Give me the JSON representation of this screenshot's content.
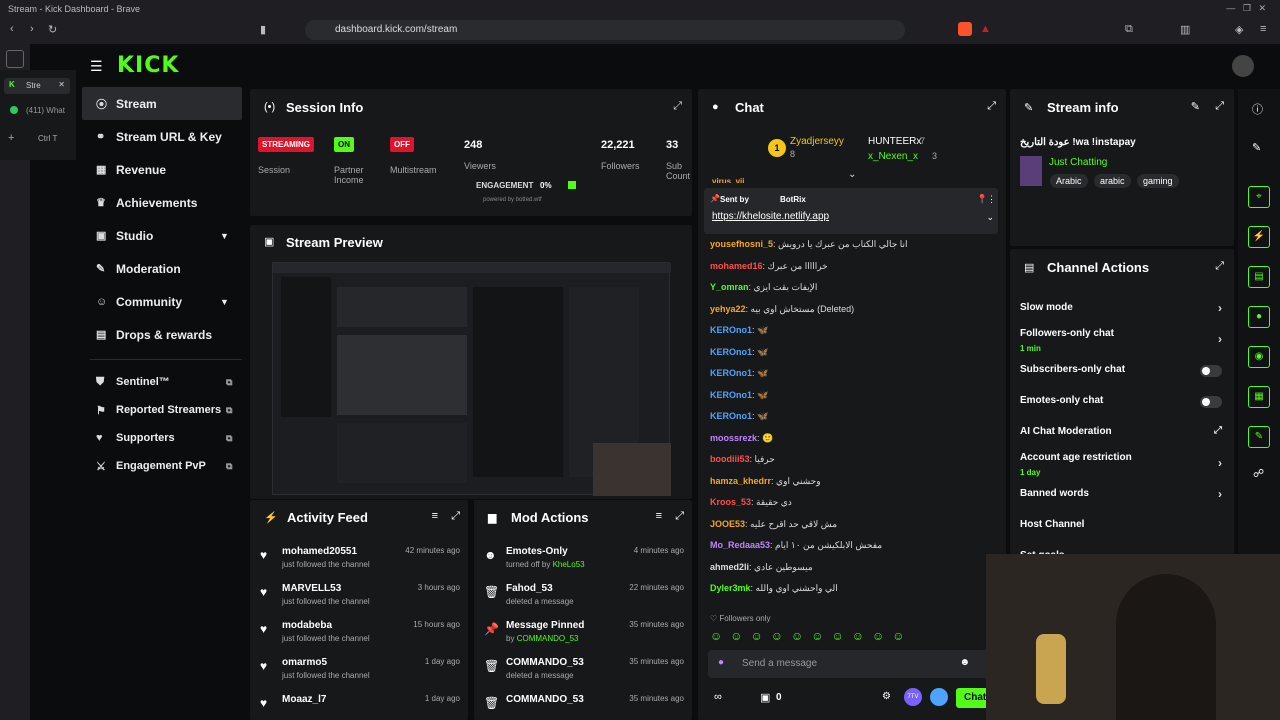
{
  "window_title": "Stream - Kick Dashboard - Brave",
  "url": "dashboard.kick.com/stream",
  "tabs": [
    {
      "label": "Stre"
    },
    {
      "label": "(411) What"
    }
  ],
  "tab_shortcut": "Ctrl T",
  "logo": "KICK",
  "sidebar": {
    "items": [
      {
        "label": "Stream"
      },
      {
        "label": "Stream URL & Key"
      },
      {
        "label": "Revenue"
      },
      {
        "label": "Achievements"
      },
      {
        "label": "Studio"
      },
      {
        "label": "Moderation"
      },
      {
        "label": "Community"
      },
      {
        "label": "Drops & rewards"
      }
    ],
    "tools": [
      {
        "label": "Sentinel™"
      },
      {
        "label": "Reported Streamers"
      },
      {
        "label": "Supporters"
      },
      {
        "label": "Engagement PvP"
      }
    ]
  },
  "session": {
    "title": "Session Info",
    "streaming": "STREAMING",
    "session_label": "Session",
    "on": "ON",
    "partner_label": "Partner Income",
    "off": "OFF",
    "multistream_label": "Multistream",
    "viewers": "248",
    "viewers_label": "Viewers",
    "followers": "22,221",
    "followers_label": "Followers",
    "subs": "33",
    "subs_label": "Sub Counts",
    "engagement_label": "ENGAGEMENT",
    "engagement": "0%",
    "powered": "powered by botted.wtf"
  },
  "preview": {
    "title": "Stream Preview"
  },
  "activity": {
    "title": "Activity Feed",
    "items": [
      {
        "name": "mohamed20551",
        "desc": "just followed the channel",
        "time": "42 minutes ago"
      },
      {
        "name": "MARVELL53",
        "desc": "just followed the channel",
        "time": "3 hours ago"
      },
      {
        "name": "modabeba",
        "desc": "just followed the channel",
        "time": "15 hours ago"
      },
      {
        "name": "omarmo5",
        "desc": "just followed the channel",
        "time": "1 day ago"
      },
      {
        "name": "Moaaz_l7",
        "desc": "",
        "time": "1 day ago"
      }
    ]
  },
  "modactions": {
    "title": "Mod Actions",
    "items": [
      {
        "name": "Emotes-Only",
        "desc": "turned off by",
        "user": "KheLo53",
        "time": "4 minutes ago"
      },
      {
        "name": "Fahod_53",
        "desc": "deleted a message",
        "user": "",
        "time": "22 minutes ago"
      },
      {
        "name": "Message Pinned",
        "desc": "by",
        "user": "COMMANDO_53",
        "time": "35 minutes ago"
      },
      {
        "name": "COMMANDO_53",
        "desc": "deleted a message",
        "user": "",
        "time": "35 minutes ago"
      },
      {
        "name": "COMMANDO_53",
        "desc": "",
        "user": "",
        "time": "35 minutes ago"
      }
    ]
  },
  "chat": {
    "title": "Chat",
    "top1": "Zyadjerseyy",
    "top1_count": "8",
    "top2": "HUNTEERx",
    "top2_count": "7",
    "top3": "x_Nexen_x",
    "top3_count": "3",
    "pinned_by": "Sent by",
    "pinned_user": "BotRix",
    "pinned_link": "https://khelosite.netlify.app",
    "cut_user": "virus_vii",
    "messages": [
      {
        "user": "yousefhosni_5",
        "text": "انا جالي الكتاب من عبرك يا درويش",
        "color": "#f5a623"
      },
      {
        "user": "mohamed16",
        "text": "خرااااا من عبرك",
        "color": "#ff4d4d"
      },
      {
        "user": "Y_omran",
        "text": "الإيفات بقت ايزي",
        "color": "#53fc18"
      },
      {
        "user": "yehya22",
        "text": "مستخاش اوي بيه (Deleted)",
        "color": "#f5a623"
      },
      {
        "user": "KEROno1",
        "text": "🦋",
        "color": "#4da3ff"
      },
      {
        "user": "KEROno1",
        "text": "🦋",
        "color": "#4da3ff"
      },
      {
        "user": "KEROno1",
        "text": "🦋",
        "color": "#4da3ff"
      },
      {
        "user": "KEROno1",
        "text": "🦋",
        "color": "#4da3ff"
      },
      {
        "user": "KEROno1",
        "text": "🦋",
        "color": "#4da3ff"
      },
      {
        "user": "moossrezk",
        "text": "🙂",
        "color": "#c084fc"
      },
      {
        "user": "boodiii53",
        "text": "حرفيا",
        "color": "#ff4d4d"
      },
      {
        "user": "hamza_khedrr",
        "text": "وحشني اوي",
        "color": "#f5a623"
      },
      {
        "user": "Kroos_53",
        "text": "دي حقيقة",
        "color": "#ff4d4d"
      },
      {
        "user": "JOOE53",
        "text": "مش لاقي حد اقرح عليه",
        "color": "#f5a623"
      },
      {
        "user": "Mo_Redaaa53",
        "text": "مفحش الابلكيشن من ١٠ ايام",
        "color": "#c084fc"
      },
      {
        "user": "ahmed2li",
        "text": "ميسوطين عادي",
        "color": "#ddd"
      },
      {
        "user": "Dyler3mk",
        "text": "الي واحشني اوي والله",
        "color": "#53fc18"
      }
    ],
    "followers_only": "Followers only",
    "placeholder": "Send a message",
    "count": "0",
    "send": "Chat"
  },
  "stream_info": {
    "title": "Stream info",
    "stream_title": "عودة التاريخ !wa !instapay",
    "category": "Just Chatting",
    "tags": [
      "Arabic",
      "arabic",
      "gaming"
    ]
  },
  "channel_actions": {
    "title": "Channel Actions",
    "items": [
      {
        "label": "Slow mode",
        "sub": "",
        "type": "arrow"
      },
      {
        "label": "Followers-only chat",
        "sub": "1 min",
        "type": "arrow"
      },
      {
        "label": "Subscribers-only chat",
        "sub": "",
        "type": "toggle"
      },
      {
        "label": "Emotes-only chat",
        "sub": "",
        "type": "toggle"
      },
      {
        "label": "AI Chat Moderation",
        "sub": "",
        "type": "ext"
      },
      {
        "label": "Account age restriction",
        "sub": "1 day",
        "type": "arrow"
      },
      {
        "label": "Banned words",
        "sub": "",
        "type": "arrow"
      },
      {
        "label": "Host Channel",
        "sub": "",
        "type": "none"
      },
      {
        "label": "Set goals",
        "sub": "",
        "type": "arrow"
      }
    ]
  },
  "colors": {
    "accent": "#53fc18",
    "streaming": "#e0132b",
    "off": "#e0132b"
  }
}
